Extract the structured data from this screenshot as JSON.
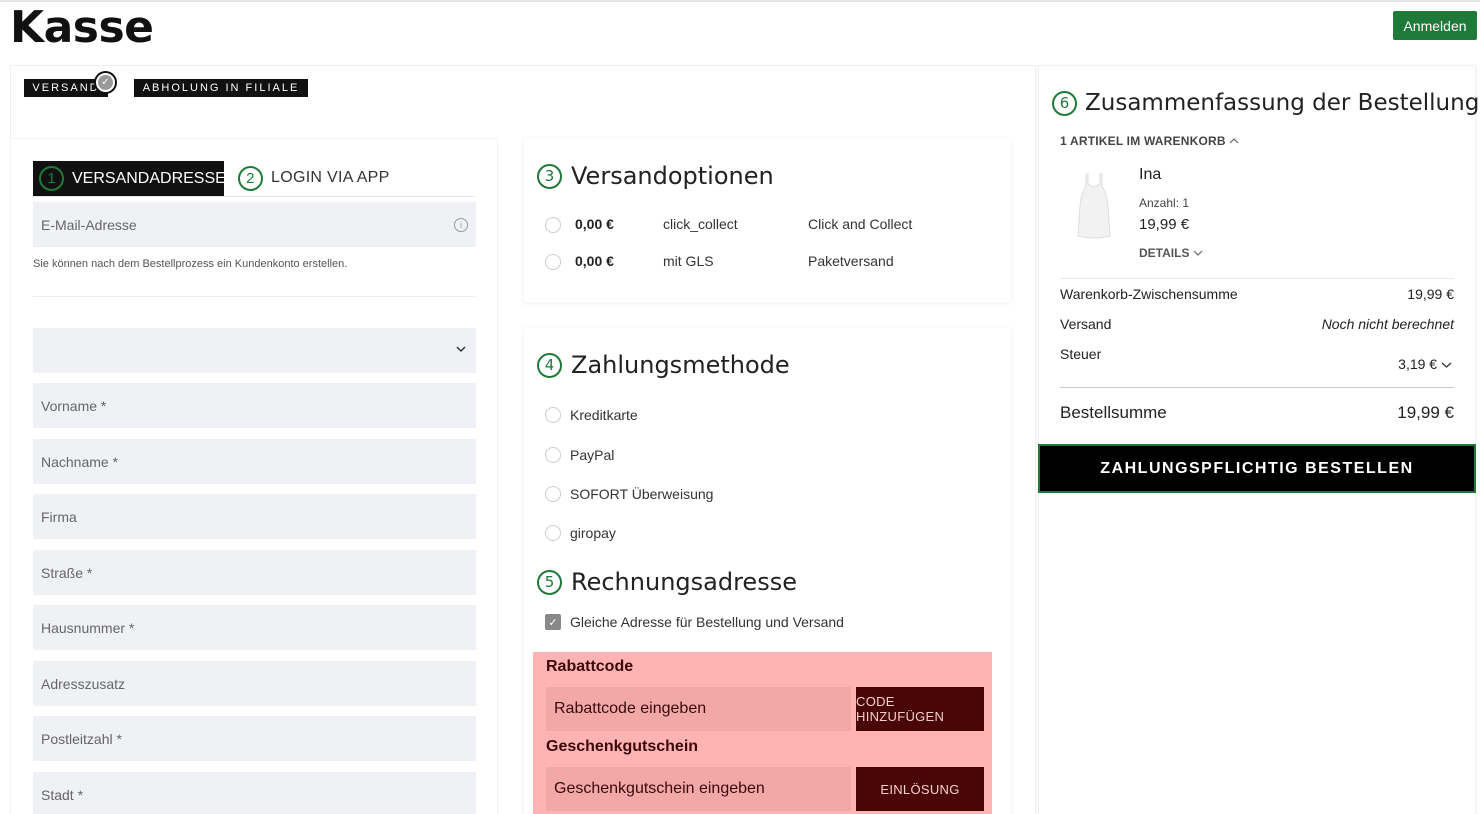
{
  "header": {
    "title": "Kasse",
    "login_label": "Anmelden"
  },
  "shipping_methods": {
    "versand": "VERSAND",
    "pickup": "ABHOLUNG IN FILIALE"
  },
  "address": {
    "step1_number": "1",
    "step1_label": "VERSANDADRESSE",
    "step2_number": "2",
    "step2_label": "LOGIN VIA APP",
    "email_placeholder": "E-Mail-Adresse",
    "hint": "Sie können nach dem Bestellprozess ein Kundenkonto erstellen.",
    "country_value": "",
    "fields": [
      "Vorname *",
      "Nachname *",
      "Firma",
      "Straße *",
      "Hausnummer *",
      "Adresszusatz",
      "Postleitzahl *",
      "Stadt *"
    ]
  },
  "shipping_options": {
    "number": "3",
    "title": "Versandoptionen",
    "options": [
      {
        "price": "0,00 €",
        "code": "click_collect",
        "name": "Click and Collect"
      },
      {
        "price": "0,00 €",
        "code": "mit GLS",
        "name": "Paketversand"
      }
    ]
  },
  "payment": {
    "number": "4",
    "title": "Zahlungsmethode",
    "methods": [
      "Kreditkarte",
      "PayPal",
      "SOFORT Überweisung",
      "giropay"
    ]
  },
  "billing": {
    "number": "5",
    "title": "Rechnungsadresse",
    "same_address_label": "Gleiche Adresse für Bestellung und Versand",
    "same_address_checked": true
  },
  "promo": {
    "coupon_label": "Rabattcode",
    "coupon_placeholder": "Rabattcode eingeben",
    "coupon_button": "CODE HINZUFÜGEN",
    "gift_label": "Geschenkgutschein",
    "gift_placeholder": "Geschenkgutschein eingeben",
    "gift_button": "EINLÖSUNG",
    "background_color": "#ffb3b3",
    "button_color": "#4a0505"
  },
  "summary": {
    "number": "6",
    "title": "Zusammenfassung der Bestellung",
    "cart_count": "1 ARTIKEL IM WARENKORB",
    "product": {
      "name": "Ina",
      "quantity": "Anzahl: 1",
      "price": "19,99 €",
      "details_label": "DETAILS"
    },
    "subtotal_label": "Warenkorb-Zwischensumme",
    "subtotal_value": "19,99 €",
    "shipping_label": "Versand",
    "shipping_value": "Noch nicht berechnet",
    "tax_label": "Steuer",
    "tax_value": "3,19 €",
    "total_label": "Bestellsumme",
    "total_value": "19,99 €",
    "order_button": "ZAHLUNGSPFLICHTIG BESTELLEN"
  },
  "colors": {
    "accent": "#1f7a3a",
    "field_bg": "#eff1f4"
  }
}
